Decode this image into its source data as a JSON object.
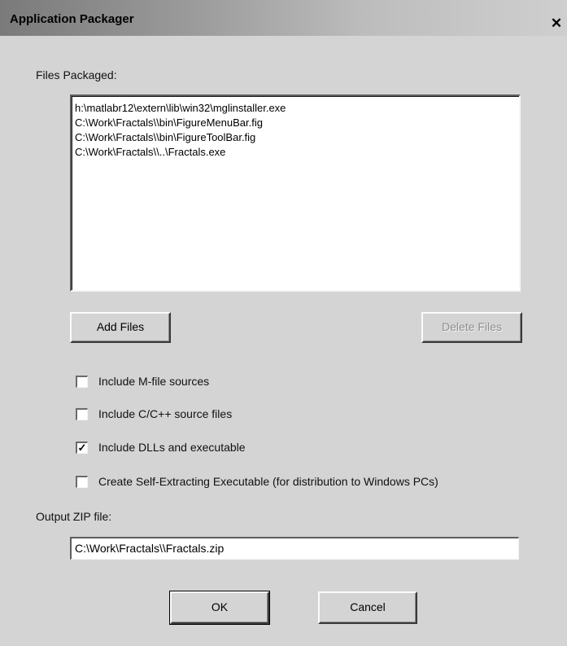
{
  "window": {
    "title": "Application Packager",
    "close_glyph": "✕"
  },
  "files_section": {
    "label": "Files Packaged:",
    "files": [
      "h:\\matlabr12\\extern\\lib\\win32\\mglinstaller.exe",
      "C:\\Work\\Fractals\\\\bin\\FigureMenuBar.fig",
      "C:\\Work\\Fractals\\\\bin\\FigureToolBar.fig",
      "C:\\Work\\Fractals\\\\..\\Fractals.exe"
    ]
  },
  "buttons": {
    "add_files": "Add Files",
    "delete_files": "Delete Files",
    "ok": "OK",
    "cancel": "Cancel"
  },
  "options": [
    {
      "label": "Include M-file sources",
      "checked": false
    },
    {
      "label": "Include C/C++ source files",
      "checked": false
    },
    {
      "label": "Include DLLs and executable",
      "checked": true
    },
    {
      "label": "Create Self-Extracting Executable (for distribution to Windows PCs)",
      "checked": false
    }
  ],
  "output": {
    "label": "Output ZIP file:",
    "value": "C:\\Work\\Fractals\\\\Fractals.zip"
  },
  "colors": {
    "dialog_bg": "#d4d4d4",
    "field_bg": "#ffffff",
    "disabled_text": "#8e8e8e"
  }
}
